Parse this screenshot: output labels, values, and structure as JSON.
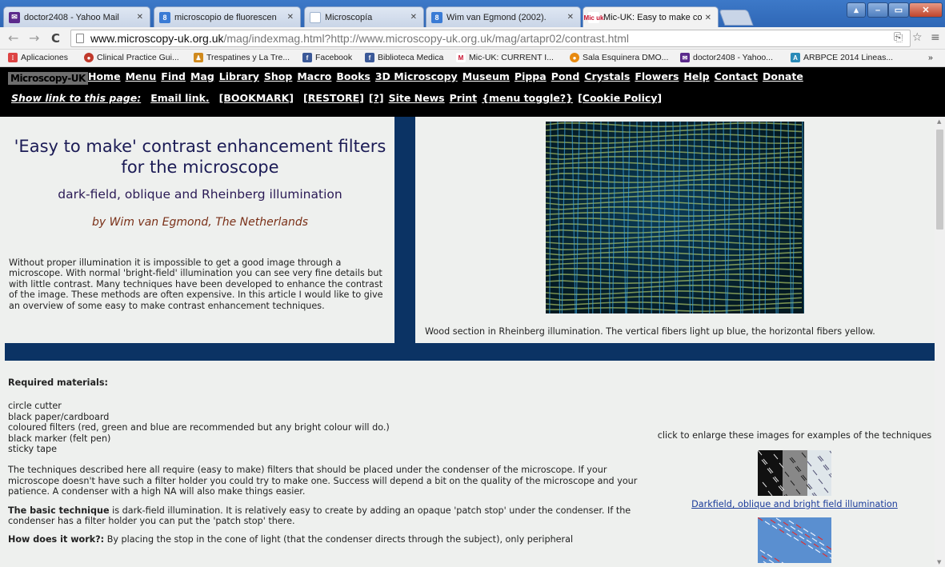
{
  "browser": {
    "tabs": [
      {
        "title": "doctor2408 - Yahoo Mail",
        "icon": "mail-icon",
        "color": "#5b2a8c"
      },
      {
        "title": "microscopio de fluorescen",
        "icon": "search-icon",
        "color": "#3a7bd5"
      },
      {
        "title": "Microscopía",
        "icon": "page-icon",
        "color": "#9fb3cf"
      },
      {
        "title": "Wim van Egmond (2002). ",
        "icon": "search-icon",
        "color": "#3a7bd5"
      },
      {
        "title": "Mic-UK: Easy to make con",
        "icon": "micuk-icon",
        "color": "#c8102e",
        "active": true
      }
    ],
    "url_host": "www.microscopy-uk.org.uk",
    "url_rest": "/mag/indexmag.html?http://www.microscopy-uk.org.uk/mag/artapr02/contrast.html",
    "bookmarks": [
      {
        "label": "Aplicaciones",
        "icon": "apps-icon",
        "color": "#d44"
      },
      {
        "label": "Clinical Practice Gui...",
        "icon": "cpg-icon",
        "color": "#c0392b"
      },
      {
        "label": "Trespatines y La Tre...",
        "icon": "figure-icon",
        "color": "#d08a1e"
      },
      {
        "label": "Facebook",
        "icon": "facebook-icon",
        "color": "#3b5998"
      },
      {
        "label": "Biblioteca Medica",
        "icon": "facebook-icon",
        "color": "#3b5998"
      },
      {
        "label": "Mic-UK: CURRENT I...",
        "icon": "micuk-icon",
        "color": "#c8102e"
      },
      {
        "label": "Sala Esquinera DMO...",
        "icon": "sala-icon",
        "color": "#e88a10"
      },
      {
        "label": "doctor2408 - Yahoo...",
        "icon": "mail-icon",
        "color": "#5b2a8c"
      },
      {
        "label": "ARBPCE 2014 Lineas...",
        "icon": "arbpce-icon",
        "color": "#2a8ab8"
      }
    ],
    "overflow": "»"
  },
  "site": {
    "logo": "Microscopy-UK",
    "nav": [
      "Home",
      "Menu",
      "Find",
      "Mag",
      "Library",
      "Shop",
      "Macro",
      "Books",
      "3D Microscopy",
      "Museum",
      "Pippa",
      "Pond",
      "Crystals",
      "Flowers",
      "Help",
      "Contact",
      "Donate"
    ],
    "subnav_label": "Show link to this page:",
    "subnav": [
      "Email link.",
      "[BOOKMARK]",
      "[RESTORE]",
      "[?]",
      "Site News",
      "Print",
      "{menu toggle?}",
      "[Cookie Policy]"
    ]
  },
  "article": {
    "title": "'Easy to make' contrast enhancement filters for the microscope",
    "subtitle": "dark-field, oblique and Rheinberg illumination",
    "author": "by Wim van Egmond, The Netherlands",
    "intro": "Without proper illumination it is impossible to get a good image through a microscope. With normal 'bright-field' illumination you can see very fine details but with little contrast. Many techniques have been developed to enhance the contrast of the image. These methods are often expensive. In this article I would like to give an overview of some easy to make contrast enhancement techniques.",
    "image_caption": "Wood section in Rheinberg illumination. The vertical fibers light up blue, the horizontal fibers yellow.",
    "materials_heading": "Required materials:",
    "materials": [
      "circle cutter",
      "black paper/cardboard",
      "coloured filters (red, green and blue are recommended but any bright colour will do.)",
      "black marker (felt pen)",
      "sticky tape"
    ],
    "para1": "The techniques described here all require (easy to make) filters that should be placed under the condenser of the microscope. If your microscope doesn't have such a filter holder you could try to make one. Success will depend a bit on the quality of the microscope and your patience. A condenser with a high NA will also make things easier.",
    "para2_bold": "The basic technique",
    "para2": " is dark-field illumination. It is relatively easy to create by adding an opaque 'patch stop' under the condenser. If the condenser has a filter holder you can put the 'patch stop' there.",
    "para3_bold": "How does it work?:",
    "para3": " By placing the stop in the cone of light (that the condenser directs through the subject), only peripheral",
    "side_text": "click to enlarge these images for examples of the techniques",
    "side_link": "Darkfield, oblique and bright field illumination"
  },
  "colors": {
    "header_bg": "#000000",
    "accent_navy": "#0b3364",
    "title": "#1b1b55",
    "author": "#7a3018",
    "link": "#1a3b9a"
  }
}
